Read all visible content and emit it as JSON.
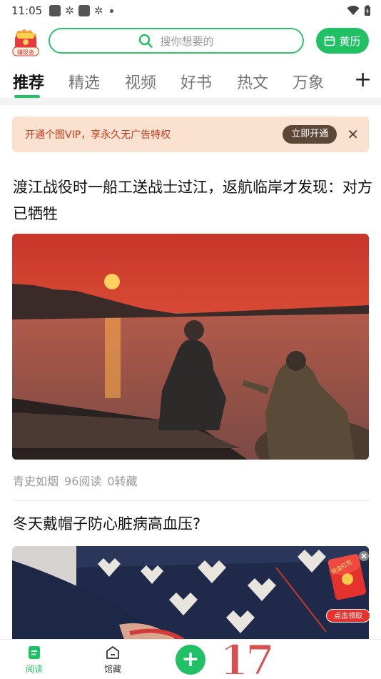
{
  "status_bar": {
    "time": "11:05"
  },
  "header": {
    "coin_label": "赚现金",
    "search_placeholder": "搜你想要的",
    "almanac_label": "黄历"
  },
  "tabs": [
    {
      "label": "推荐"
    },
    {
      "label": "精选"
    },
    {
      "label": "视频"
    },
    {
      "label": "好书"
    },
    {
      "label": "热文"
    },
    {
      "label": "万象"
    }
  ],
  "vip_banner": {
    "text": "开通个图VIP，享永久无广告特权",
    "button": "立即开通"
  },
  "articles": [
    {
      "title": "渡江战役时一船工送战士过江，返航临岸才发现：对方已牺牲",
      "author": "青史如烟",
      "reads": "96阅读",
      "saves": "0转藏"
    },
    {
      "title": "冬天戴帽子防心脏病高血压?"
    }
  ],
  "red_packet": {
    "label": "现金红包",
    "claim": "点击领取"
  },
  "bottom_nav": {
    "read": "阅读",
    "library": "馆藏",
    "watermark": "17"
  },
  "colors": {
    "accent": "#20c164",
    "vip_text": "#c43b1d",
    "vip_bg": "#fbe1cf"
  }
}
